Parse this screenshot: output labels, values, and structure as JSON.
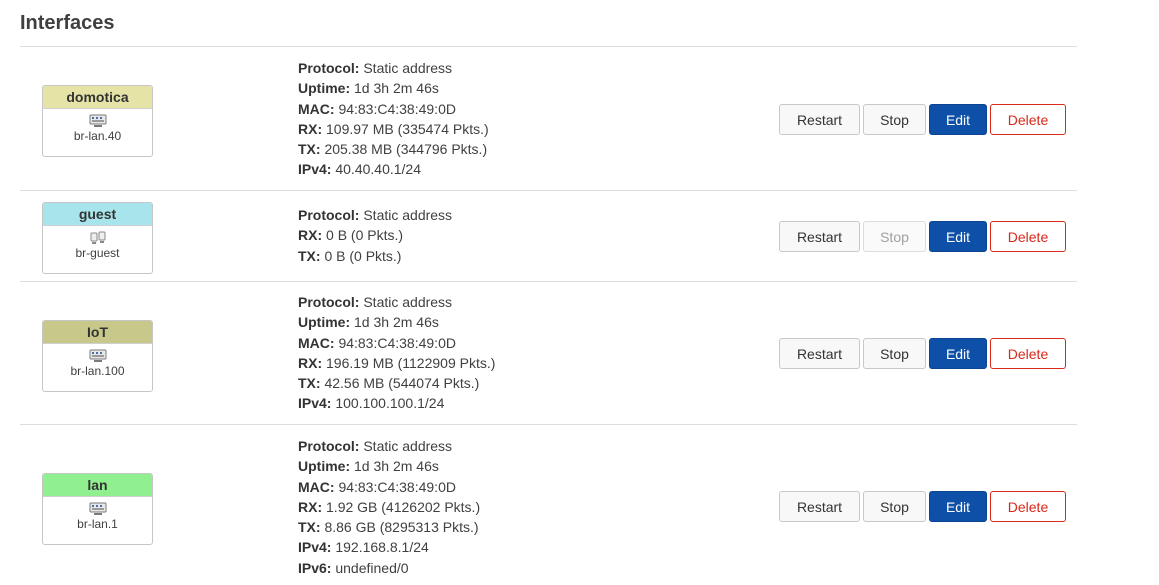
{
  "page": {
    "title": "Interfaces"
  },
  "buttons": {
    "restart": "Restart",
    "stop": "Stop",
    "edit": "Edit",
    "delete": "Delete"
  },
  "interfaces": [
    {
      "name": "domotica",
      "device": "br-lan.40",
      "color": "#e5e4a6",
      "icon": "ethernet-icon",
      "stop_enabled": true,
      "details": [
        {
          "label": "Protocol:",
          "value": "Static address"
        },
        {
          "label": "Uptime:",
          "value": "1d 3h 2m 46s"
        },
        {
          "label": "MAC:",
          "value": "94:83:C4:38:49:0D"
        },
        {
          "label": "RX:",
          "value": "109.97 MB (335474 Pkts.)"
        },
        {
          "label": "TX:",
          "value": "205.38 MB (344796 Pkts.)"
        },
        {
          "label": "IPv4:",
          "value": "40.40.40.1/24"
        }
      ]
    },
    {
      "name": "guest",
      "device": "br-guest",
      "color": "#a8e4ec",
      "icon": "ethernet-disconnected-icon",
      "stop_enabled": false,
      "details": [
        {
          "label": "Protocol:",
          "value": "Static address"
        },
        {
          "label": "RX:",
          "value": "0 B (0 Pkts.)"
        },
        {
          "label": "TX:",
          "value": "0 B (0 Pkts.)"
        }
      ]
    },
    {
      "name": "IoT",
      "device": "br-lan.100",
      "color": "#c8c88a",
      "icon": "ethernet-icon",
      "stop_enabled": true,
      "details": [
        {
          "label": "Protocol:",
          "value": "Static address"
        },
        {
          "label": "Uptime:",
          "value": "1d 3h 2m 46s"
        },
        {
          "label": "MAC:",
          "value": "94:83:C4:38:49:0D"
        },
        {
          "label": "RX:",
          "value": "196.19 MB (1122909 Pkts.)"
        },
        {
          "label": "TX:",
          "value": "42.56 MB (544074 Pkts.)"
        },
        {
          "label": "IPv4:",
          "value": "100.100.100.1/24"
        }
      ]
    },
    {
      "name": "lan",
      "device": "br-lan.1",
      "color": "#90f090",
      "icon": "ethernet-icon",
      "stop_enabled": true,
      "details": [
        {
          "label": "Protocol:",
          "value": "Static address"
        },
        {
          "label": "Uptime:",
          "value": "1d 3h 2m 46s"
        },
        {
          "label": "MAC:",
          "value": "94:83:C4:38:49:0D"
        },
        {
          "label": "RX:",
          "value": "1.92 GB (4126202 Pkts.)"
        },
        {
          "label": "TX:",
          "value": "8.86 GB (8295313 Pkts.)"
        },
        {
          "label": "IPv4:",
          "value": "192.168.8.1/24"
        },
        {
          "label": "IPv6:",
          "value": "undefined/0"
        }
      ]
    }
  ]
}
